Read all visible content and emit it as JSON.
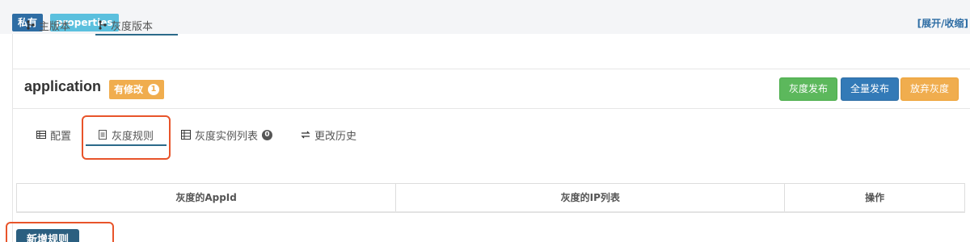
{
  "header": {
    "scope_tag": "私有",
    "format_tag": "properties",
    "toggle_link": "[展开/收缩]"
  },
  "branch_tabs": {
    "main_label": "主版本",
    "gray_label": "灰度版本",
    "active": "gray"
  },
  "namespace": {
    "name": "application",
    "modified_label": "有修改",
    "modified_count": "1"
  },
  "actions": {
    "gray_release": "灰度发布",
    "full_release": "全量发布",
    "abandon_gray": "放弃灰度"
  },
  "sub_tabs": {
    "config": "配置",
    "gray_rules": "灰度规则",
    "gray_instances": "灰度实例列表",
    "gray_instances_count": "0",
    "history": "更改历史",
    "active": "gray_rules"
  },
  "rules_table": {
    "columns": [
      "灰度的AppId",
      "灰度的IP列表",
      "操作"
    ],
    "rows": []
  },
  "new_rule_button": "新增规则",
  "colors": {
    "primary": "#337ab7",
    "success": "#5cb85c",
    "warning": "#f0ad4e",
    "info": "#5bc0de",
    "highlight": "#e8542a"
  },
  "icons": {
    "branch": "branch-icon",
    "config": "table-icon",
    "rules": "document-icon",
    "instances": "server-icon",
    "history": "exchange-icon"
  }
}
